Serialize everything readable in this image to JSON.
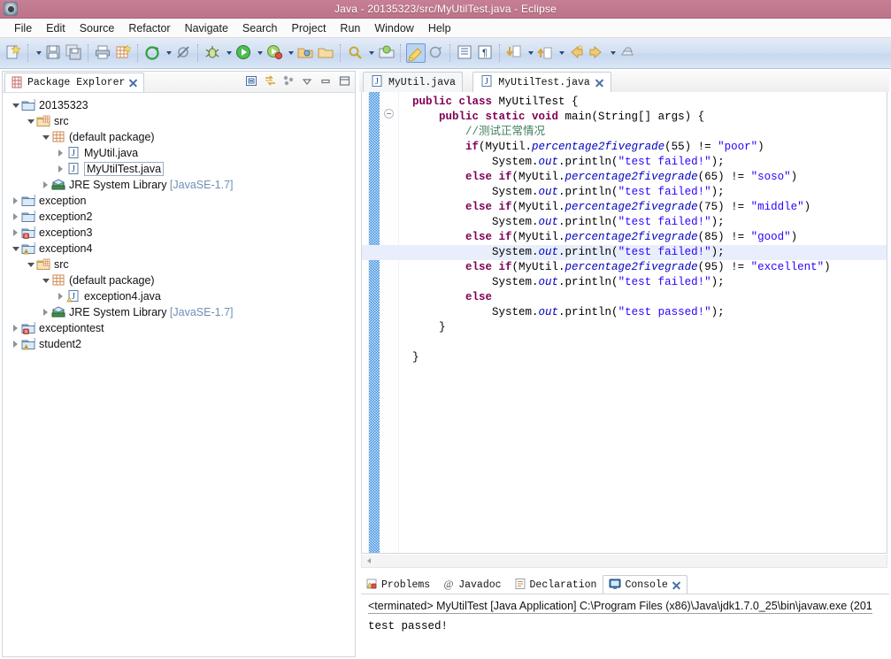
{
  "window": {
    "title": "Java - 20135323/src/MyUtilTest.java - Eclipse",
    "icon": "eclipse-app-icon"
  },
  "menubar": {
    "items": [
      {
        "label": "File"
      },
      {
        "label": "Edit"
      },
      {
        "label": "Source"
      },
      {
        "label": "Refactor"
      },
      {
        "label": "Navigate"
      },
      {
        "label": "Search"
      },
      {
        "label": "Project"
      },
      {
        "label": "Run"
      },
      {
        "label": "Window"
      },
      {
        "label": "Help"
      }
    ]
  },
  "toolbar": {
    "buttons": [
      {
        "name": "new-wizard-icon",
        "title": "New"
      },
      {
        "name": "new-dropdown-arrow",
        "title": "New menu"
      },
      {
        "name": "save-icon",
        "title": "Save"
      },
      {
        "name": "save-all-icon",
        "title": "Save All"
      },
      {
        "name": "print-icon",
        "title": "Print"
      },
      {
        "name": "new-java-package-icon",
        "title": "New Java Package"
      },
      {
        "name": "build-all-icon",
        "title": "Build All"
      },
      {
        "name": "build-dropdown-arrow",
        "title": "Build menu"
      },
      {
        "name": "skip-breakpoints-icon",
        "title": "Skip All Breakpoints"
      },
      {
        "name": "debug-icon",
        "title": "Debug"
      },
      {
        "name": "debug-dropdown-arrow",
        "title": "Debug menu"
      },
      {
        "name": "run-icon",
        "title": "Run"
      },
      {
        "name": "run-dropdown-arrow",
        "title": "Run menu"
      },
      {
        "name": "run-coverage-icon",
        "title": "Coverage"
      },
      {
        "name": "coverage-dropdown-arrow",
        "title": "Coverage menu"
      },
      {
        "name": "open-type-icon",
        "title": "Open Type"
      },
      {
        "name": "open-task-icon",
        "title": "Open Task"
      },
      {
        "name": "search-icon",
        "title": "Search"
      },
      {
        "name": "search-dropdown-arrow",
        "title": "Search menu"
      },
      {
        "name": "next-annotation-icon",
        "title": "Next Annotation"
      },
      {
        "name": "pencil-highlight-icon",
        "title": "Toggle Mark Occurrences"
      },
      {
        "name": "previous-edit-icon",
        "title": "Last Edit Location"
      },
      {
        "name": "toggle-block-selection-icon",
        "title": "Toggle Block Selection"
      },
      {
        "name": "show-whitespace-icon",
        "title": "Show Whitespace Characters"
      },
      {
        "name": "next-annotation-down-icon",
        "title": "Next Annotation"
      },
      {
        "name": "next-annotation-dropdown-arrow",
        "title": "Next Annotation menu"
      },
      {
        "name": "previous-annotation-icon",
        "title": "Previous Annotation"
      },
      {
        "name": "previous-annotation-dropdown-arrow",
        "title": "Previous Annotation menu"
      },
      {
        "name": "back-icon",
        "title": "Back"
      },
      {
        "name": "forward-icon",
        "title": "Forward"
      },
      {
        "name": "forward-dropdown-arrow",
        "title": "Forward menu"
      },
      {
        "name": "pin-editor-icon",
        "title": "Pin Editor"
      }
    ]
  },
  "explorer": {
    "tab_label": "Package Explorer",
    "tab_icon": "package-explorer-icon",
    "view_tools": [
      {
        "name": "collapse-all-icon"
      },
      {
        "name": "link-with-editor-icon"
      },
      {
        "name": "view-menu-dots-icon"
      },
      {
        "name": "view-chevron-down-icon"
      },
      {
        "name": "minimize-icon"
      },
      {
        "name": "maximize-icon"
      }
    ],
    "tree": [
      {
        "label": "20135323",
        "indent": 0,
        "twisty": "open",
        "icon": "java-project-icon",
        "selected": false
      },
      {
        "label": "src",
        "indent": 1,
        "twisty": "open",
        "icon": "source-folder-icon",
        "selected": false
      },
      {
        "label": "(default package)",
        "indent": 2,
        "twisty": "open",
        "icon": "package-icon",
        "selected": false
      },
      {
        "label": "MyUtil.java",
        "indent": 3,
        "twisty": "closed",
        "icon": "java-file-icon",
        "selected": false
      },
      {
        "label": "MyUtilTest.java",
        "indent": 3,
        "twisty": "closed",
        "icon": "java-file-icon",
        "selected": true
      },
      {
        "label": "JRE System Library",
        "suffix": " [JavaSE-1.7]",
        "indent": 2,
        "twisty": "closed",
        "icon": "jre-library-icon",
        "selected": false
      },
      {
        "label": "exception",
        "indent": 0,
        "twisty": "closed",
        "icon": "java-project-icon",
        "selected": false
      },
      {
        "label": "exception2",
        "indent": 0,
        "twisty": "closed",
        "icon": "java-project-icon",
        "selected": false
      },
      {
        "label": "exception3",
        "indent": 0,
        "twisty": "closed",
        "icon": "java-project-error-icon",
        "selected": false
      },
      {
        "label": "exception4",
        "indent": 0,
        "twisty": "open",
        "icon": "java-project-warning-icon",
        "selected": false
      },
      {
        "label": "src",
        "indent": 1,
        "twisty": "open",
        "icon": "source-folder-icon",
        "selected": false
      },
      {
        "label": "(default package)",
        "indent": 2,
        "twisty": "open",
        "icon": "package-icon",
        "selected": false
      },
      {
        "label": "exception4.java",
        "indent": 3,
        "twisty": "closed",
        "icon": "java-file-warning-icon",
        "selected": false
      },
      {
        "label": "JRE System Library",
        "suffix": " [JavaSE-1.7]",
        "indent": 2,
        "twisty": "closed",
        "icon": "jre-library-icon",
        "selected": false
      },
      {
        "label": "exceptiontest",
        "indent": 0,
        "twisty": "closed",
        "icon": "java-project-error-icon",
        "selected": false
      },
      {
        "label": "student2",
        "indent": 0,
        "twisty": "closed",
        "icon": "java-project-warning-icon",
        "selected": false
      }
    ]
  },
  "editor": {
    "tabs": [
      {
        "label": "MyUtil.java",
        "icon": "java-file-icon",
        "active": false,
        "closable": false
      },
      {
        "label": "MyUtilTest.java",
        "icon": "java-file-icon",
        "active": true,
        "closable": true
      }
    ],
    "highlighted_line": 11,
    "code_lines": [
      [
        {
          "t": "  ",
          "c": ""
        },
        {
          "t": "public class ",
          "c": "kw"
        },
        {
          "t": "MyUtilTest {",
          "c": ""
        }
      ],
      [
        {
          "t": "      ",
          "c": ""
        },
        {
          "t": "public static void ",
          "c": "kw"
        },
        {
          "t": "main(String[] args) {",
          "c": ""
        }
      ],
      [
        {
          "t": "          ",
          "c": ""
        },
        {
          "t": "//测试正常情况",
          "c": "cmt"
        }
      ],
      [
        {
          "t": "          ",
          "c": ""
        },
        {
          "t": "if",
          "c": "kw"
        },
        {
          "t": "(MyUtil.",
          "c": ""
        },
        {
          "t": "percentage2fivegrade",
          "c": "fld"
        },
        {
          "t": "(55) != ",
          "c": ""
        },
        {
          "t": "\"poor\"",
          "c": "str"
        },
        {
          "t": ")",
          "c": ""
        }
      ],
      [
        {
          "t": "              System.",
          "c": ""
        },
        {
          "t": "out",
          "c": "fld"
        },
        {
          "t": ".println(",
          "c": ""
        },
        {
          "t": "\"test failed!\"",
          "c": "str"
        },
        {
          "t": ");",
          "c": ""
        }
      ],
      [
        {
          "t": "          ",
          "c": ""
        },
        {
          "t": "else if",
          "c": "kw"
        },
        {
          "t": "(MyUtil.",
          "c": ""
        },
        {
          "t": "percentage2fivegrade",
          "c": "fld"
        },
        {
          "t": "(65) != ",
          "c": ""
        },
        {
          "t": "\"soso\"",
          "c": "str"
        },
        {
          "t": ")",
          "c": ""
        }
      ],
      [
        {
          "t": "              System.",
          "c": ""
        },
        {
          "t": "out",
          "c": "fld"
        },
        {
          "t": ".println(",
          "c": ""
        },
        {
          "t": "\"test failed!\"",
          "c": "str"
        },
        {
          "t": ");",
          "c": ""
        }
      ],
      [
        {
          "t": "          ",
          "c": ""
        },
        {
          "t": "else if",
          "c": "kw"
        },
        {
          "t": "(MyUtil.",
          "c": ""
        },
        {
          "t": "percentage2fivegrade",
          "c": "fld"
        },
        {
          "t": "(75) != ",
          "c": ""
        },
        {
          "t": "\"middle\"",
          "c": "str"
        },
        {
          "t": ")",
          "c": ""
        }
      ],
      [
        {
          "t": "              System.",
          "c": ""
        },
        {
          "t": "out",
          "c": "fld"
        },
        {
          "t": ".println(",
          "c": ""
        },
        {
          "t": "\"test failed!\"",
          "c": "str"
        },
        {
          "t": ");",
          "c": ""
        }
      ],
      [
        {
          "t": "          ",
          "c": ""
        },
        {
          "t": "else if",
          "c": "kw"
        },
        {
          "t": "(MyUtil.",
          "c": ""
        },
        {
          "t": "percentage2fivegrade",
          "c": "fld"
        },
        {
          "t": "(85) != ",
          "c": ""
        },
        {
          "t": "\"good\"",
          "c": "str"
        },
        {
          "t": ")",
          "c": ""
        }
      ],
      [
        {
          "t": "              System.",
          "c": ""
        },
        {
          "t": "out",
          "c": "fld"
        },
        {
          "t": ".println(",
          "c": ""
        },
        {
          "t": "\"test failed!\"",
          "c": "str"
        },
        {
          "t": ");",
          "c": ""
        }
      ],
      [
        {
          "t": "          ",
          "c": ""
        },
        {
          "t": "else if",
          "c": "kw"
        },
        {
          "t": "(MyUtil.",
          "c": ""
        },
        {
          "t": "percentage2fivegrade",
          "c": "fld"
        },
        {
          "t": "(95) != ",
          "c": ""
        },
        {
          "t": "\"excellent\"",
          "c": "str"
        },
        {
          "t": ")",
          "c": ""
        }
      ],
      [
        {
          "t": "              System.",
          "c": ""
        },
        {
          "t": "out",
          "c": "fld"
        },
        {
          "t": ".println(",
          "c": ""
        },
        {
          "t": "\"test failed!\"",
          "c": "str"
        },
        {
          "t": ");",
          "c": ""
        }
      ],
      [
        {
          "t": "          ",
          "c": ""
        },
        {
          "t": "else",
          "c": "kw"
        }
      ],
      [
        {
          "t": "              System.",
          "c": ""
        },
        {
          "t": "out",
          "c": "fld"
        },
        {
          "t": ".println(",
          "c": ""
        },
        {
          "t": "\"test passed!\"",
          "c": "str"
        },
        {
          "t": ");",
          "c": ""
        }
      ],
      [
        {
          "t": "      }",
          "c": ""
        }
      ],
      [
        {
          "t": "",
          "c": ""
        }
      ],
      [
        {
          "t": "  }",
          "c": ""
        }
      ]
    ],
    "hscroll_left_arrow": "scroll-left-arrow"
  },
  "bottom_panel": {
    "tabs": [
      {
        "label": "Problems",
        "icon": "problems-icon",
        "active": false,
        "closable": false
      },
      {
        "label": "Javadoc",
        "icon": "javadoc-icon",
        "active": false,
        "closable": false
      },
      {
        "label": "Declaration",
        "icon": "declaration-icon",
        "active": false,
        "closable": false
      },
      {
        "label": "Console",
        "icon": "console-icon",
        "active": true,
        "closable": true
      }
    ],
    "console_header": "<terminated> MyUtilTest [Java Application] C:\\Program Files (x86)\\Java\\jdk1.7.0_25\\bin\\javaw.exe (201",
    "console_output": "test passed!"
  },
  "colors": {
    "titlebar": "#c1798f",
    "toolbar": "#d3e0f2",
    "keyword": "#7f0055",
    "string": "#2a00ff",
    "comment": "#3f7f5f",
    "field": "#0000c0",
    "selection_highlight": "#e8eefb",
    "fold_band": "#3b8fe0"
  }
}
